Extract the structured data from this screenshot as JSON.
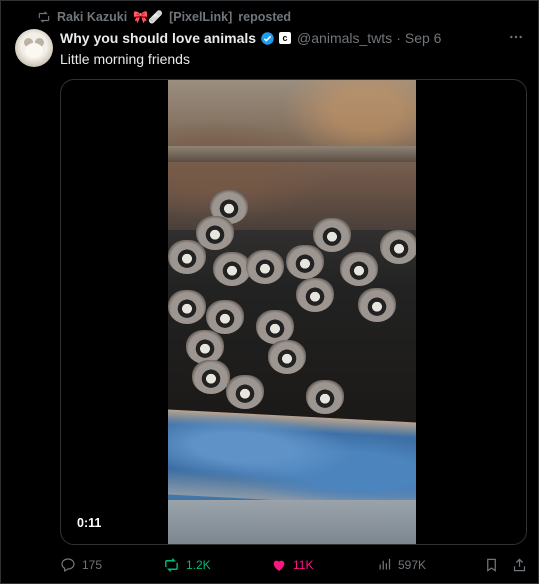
{
  "repost_banner": {
    "reposter_name": "Raki Kazuki",
    "reposter_tag": "[PixelLink]",
    "reposted_label": "reposted",
    "emoji": "🎀🩹"
  },
  "tweet": {
    "author_name": "Why you should love animals",
    "affiliation_badge": "c",
    "handle": "@animals_twts",
    "separator": "·",
    "date": "Sep 6",
    "more_label": "···",
    "text": "Little morning friends"
  },
  "media": {
    "duration": "0:11"
  },
  "actions": {
    "replies": "175",
    "reposts": "1.2K",
    "likes": "11K",
    "views": "597K"
  },
  "colors": {
    "background": "#000000",
    "repost_active": "#00ba7c",
    "like_active": "#f91880",
    "muted": "#71767b",
    "verified": "#1d9bf0"
  },
  "icons": [
    "repost-icon",
    "verified-badge-icon",
    "more-icon",
    "reply-icon",
    "repost-icon",
    "heart-icon",
    "views-icon",
    "bookmark-icon",
    "share-icon"
  ]
}
